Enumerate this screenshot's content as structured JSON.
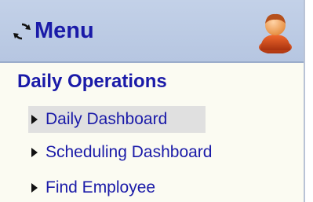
{
  "header": {
    "title": "Menu",
    "refresh_icon": "refresh-icon",
    "user_icon": "user-avatar-icon"
  },
  "section": {
    "title": "Daily Operations",
    "items": [
      {
        "label": "Daily Dashboard",
        "selected": true
      },
      {
        "label": "Scheduling Dashboard",
        "selected": false
      },
      {
        "label": "Find Employee",
        "selected": false
      }
    ]
  },
  "colors": {
    "header_bg": "#c3d1e8",
    "panel_bg": "#fbfbf2",
    "link": "#1a1aa8",
    "selected_bg": "#e0e0e0"
  }
}
